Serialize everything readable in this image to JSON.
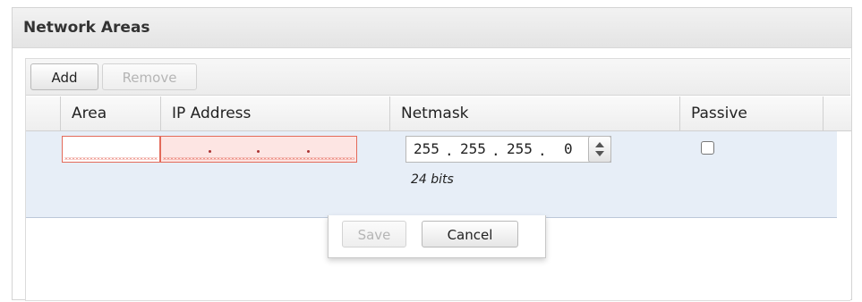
{
  "panel": {
    "title": "Network Areas"
  },
  "toolbar": {
    "add_label": "Add",
    "remove_label": "Remove"
  },
  "columns": {
    "area": "Area",
    "ip_address": "IP Address",
    "netmask": "Netmask",
    "passive": "Passive"
  },
  "edit_row": {
    "area_value": "",
    "ip_value": "",
    "netmask_octets": [
      "255",
      "255",
      "255",
      "0"
    ],
    "netmask_bits": "24 bits",
    "passive_checked": false
  },
  "actions": {
    "save_label": "Save",
    "cancel_label": "Cancel"
  },
  "colors": {
    "error_border": "#e36a5a",
    "error_fill": "#fde5e3",
    "edit_row_bg": "#e7eef7"
  },
  "icons": {
    "spinner": "up-down-spinner-icon",
    "checkbox": "checkbox-icon"
  }
}
